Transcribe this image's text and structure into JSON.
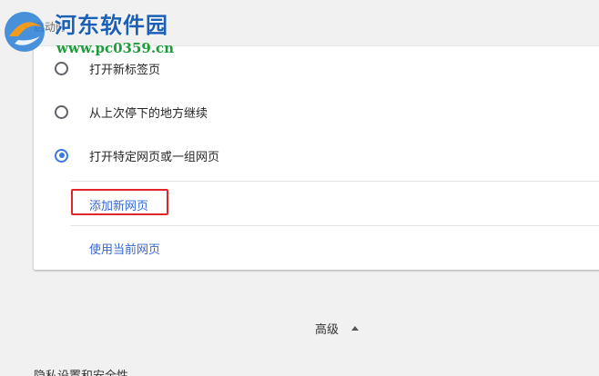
{
  "section_title": "启动时",
  "watermark": {
    "title": "河东软件园",
    "url": "www.pc0359.cn"
  },
  "startup_options": [
    {
      "label": "打开新标签页",
      "checked": false
    },
    {
      "label": "从上次停下的地方继续",
      "checked": false
    },
    {
      "label": "打开特定网页或一组网页",
      "checked": true
    }
  ],
  "links": {
    "add_page": "添加新网页",
    "use_current": "使用当前网页"
  },
  "advanced": {
    "label": "高级",
    "icon": "triangle-up-icon"
  },
  "next_section_title": "隐私设置和安全性",
  "colors": {
    "accent": "#3a78e0",
    "link": "#3367d6",
    "highlight": "#e02626"
  }
}
